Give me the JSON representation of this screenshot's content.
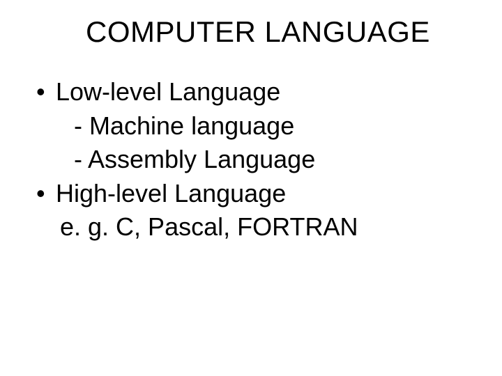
{
  "slide": {
    "title": "COMPUTER LANGUAGE",
    "bullet1": "Low-level Language",
    "sub1": "- Machine language",
    "sub2": "- Assembly Language",
    "bullet2": "High-level Language",
    "examples": "e. g. C, Pascal, FORTRAN"
  }
}
